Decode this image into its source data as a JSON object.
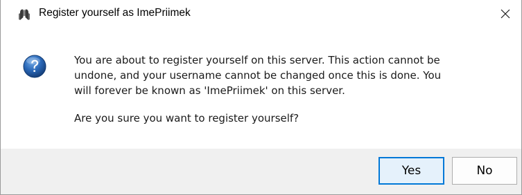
{
  "window": {
    "title": "Register yourself as ImePriimek",
    "app_icon": "mumble-app-icon",
    "close_icon": "close-icon"
  },
  "dialog": {
    "icon": "question-icon",
    "message": "You are about to register yourself on this server. This action cannot be\nundone, and your username cannot be changed once this is done. You\nwill forever be known as 'ImePriimek' on this server.",
    "question": "Are you sure you want to register yourself?"
  },
  "buttons": {
    "yes_label": "Yes",
    "no_label": "No"
  },
  "colors": {
    "accent": "#0078d7",
    "button_hover_bg": "#e5f1fb",
    "footer_bg": "#f0f0f0",
    "icon_blue": "#1f5fae"
  }
}
